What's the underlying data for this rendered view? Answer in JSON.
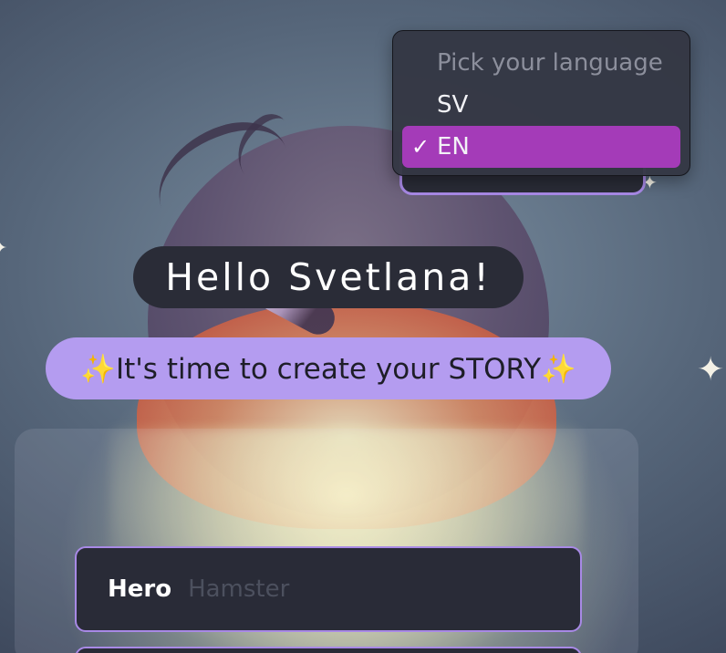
{
  "greeting": "Hello Svetlana!",
  "subtitle": "✨It's time to create your STORY✨",
  "form": {
    "hero_label": "Hero",
    "hero_placeholder": "Hamster"
  },
  "language_menu": {
    "options": [
      {
        "label": "Pick your language",
        "disabled": true
      },
      {
        "label": "SV"
      },
      {
        "label": "EN",
        "selected": true
      }
    ],
    "check_glyph": "✓"
  },
  "colors": {
    "accent_purple": "#b49cf0",
    "border_purple": "#a889e6",
    "selected_magenta": "#a43bb8",
    "pill_dark": "#2a2c37"
  }
}
